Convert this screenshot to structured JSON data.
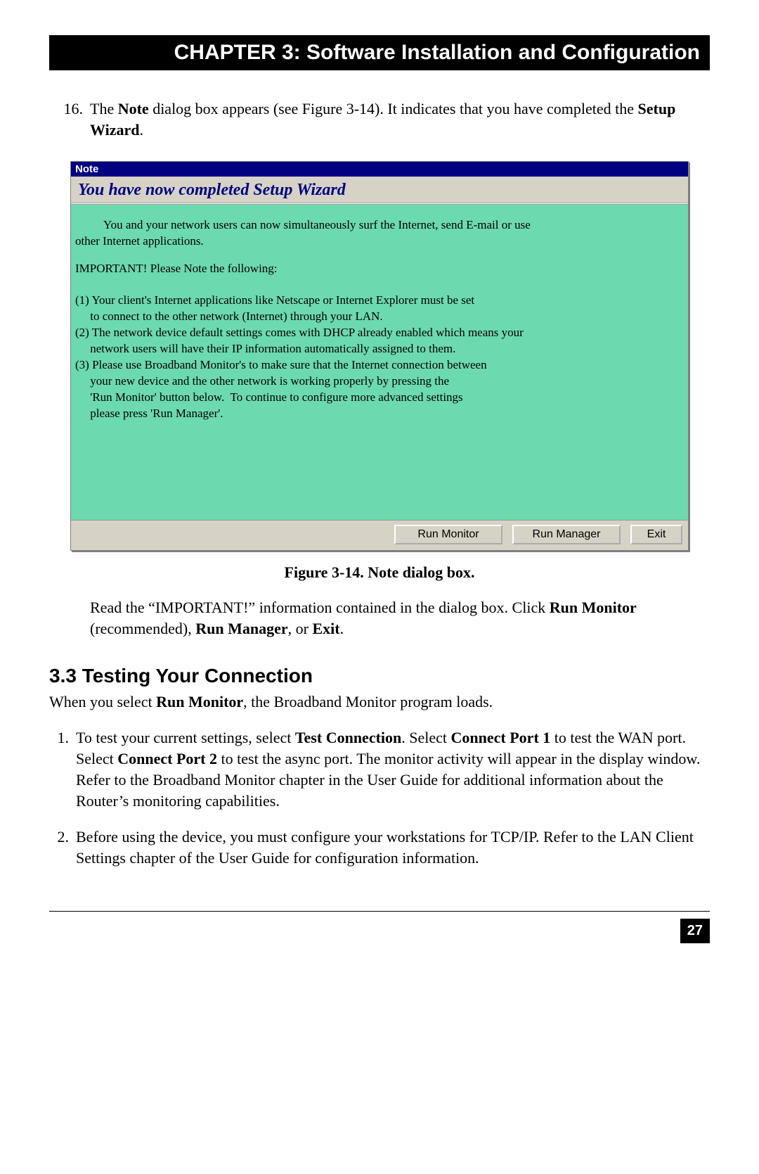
{
  "chapter_bar": "CHAPTER 3: Software Installation and Configuration",
  "step16": {
    "num": "16.",
    "t1": "The ",
    "b1": "Note",
    "t2": " dialog box appears (see Figure 3-14). It indicates that you have completed the ",
    "b2": "Setup Wizard",
    "t3": "."
  },
  "dialog": {
    "titlebar": "Note",
    "header": "You have now completed Setup Wizard",
    "intro_a": "You and your network users can now simultaneously surf the Internet, send E-mail or use",
    "intro_b": "other Internet applications.",
    "important": "IMPORTANT! Please Note the following:",
    "points": "(1) Your client's Internet applications like Netscape or Internet Explorer must be set\n     to connect to the other network (Internet) through your LAN.\n(2) The network device default settings comes with DHCP already enabled which means your\n     network users will have their IP information automatically assigned to them.\n(3) Please use Broadband Monitor's to make sure that the Internet connection between\n     your new device and the other network is working properly by pressing the\n     'Run Monitor' button below.  To continue to configure more advanced settings\n     please press 'Run Manager'.",
    "btn_run_monitor": "Run Monitor",
    "btn_run_manager": "Run Manager",
    "btn_exit": "Exit"
  },
  "fig_caption": "Figure 3-14. Note dialog box.",
  "post_fig": {
    "t1": "Read the “IMPORTANT!” information contained in the dialog box. Click ",
    "b1": "Run Monitor",
    "t2": " (recommended), ",
    "b2": "Run Manager",
    "t3": ", or ",
    "b3": "Exit",
    "t4": "."
  },
  "section_heading": "3.3 Testing Your Connection",
  "section_intro": {
    "t1": "When you select ",
    "b1": "Run Monitor",
    "t2": ", the Broadband Monitor program loads."
  },
  "list": {
    "n1": "1.",
    "i1_t1": "To test your current settings, select ",
    "i1_b1": "Test Connection",
    "i1_t2": ". Select ",
    "i1_b2": "Connect Port 1",
    "i1_t3": " to test the WAN port. Select ",
    "i1_b3": "Connect Port 2",
    "i1_t4": " to test the async port. The monitor activity will appear in the display window. Refer to the Broadband Monitor chapter in the User Guide for additional information about the Router’s monitoring capabilities.",
    "n2": "2.",
    "i2": "Before using the device, you must configure your workstations for TCP/IP. Refer to the LAN Client Settings chapter of the User Guide for configuration information."
  },
  "page_number": "27"
}
